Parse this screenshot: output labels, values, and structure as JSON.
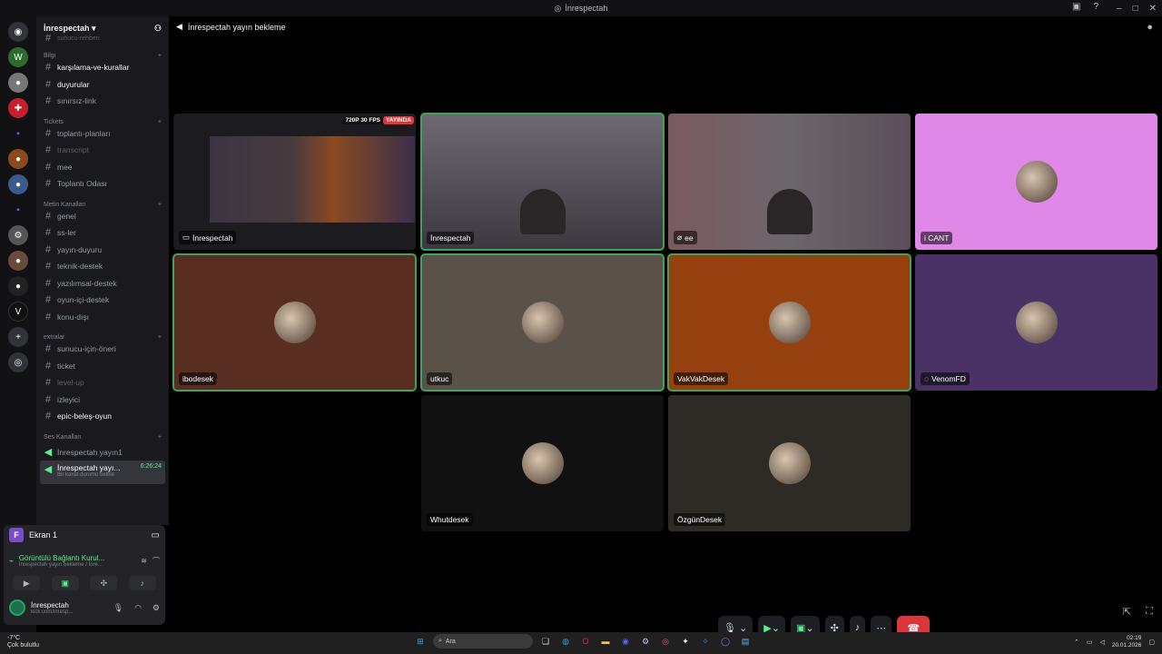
{
  "window": {
    "title": "İnrespectah"
  },
  "server": {
    "name": "İnrespectah"
  },
  "sidebar": {
    "top_partial": "sunucu-rehberi",
    "categories": [
      {
        "name": "Bilgi",
        "channels": [
          {
            "name": "karşılama-ve-kurallar",
            "state": "bright"
          },
          {
            "name": "duyurular",
            "state": "bright"
          },
          {
            "name": "sınırsız-link",
            "state": "normal"
          }
        ]
      },
      {
        "name": "Tickets",
        "channels": [
          {
            "name": "toplantı-planları",
            "state": "normal"
          },
          {
            "name": "transcript",
            "state": "dim"
          },
          {
            "name": "mee",
            "state": "normal"
          },
          {
            "name": "Toplantı Odası",
            "state": "normal"
          }
        ]
      },
      {
        "name": "Metin Kanalları",
        "channels": [
          {
            "name": "genel",
            "state": "normal"
          },
          {
            "name": "ss-ler",
            "state": "normal"
          },
          {
            "name": "yayın-duyuru",
            "state": "normal"
          },
          {
            "name": "teknik-destek",
            "state": "normal"
          },
          {
            "name": "yazılımsal-destek",
            "state": "normal"
          },
          {
            "name": "oyun-içi-destek",
            "state": "normal"
          },
          {
            "name": "konu-dışı",
            "state": "normal"
          }
        ]
      },
      {
        "name": "extralar",
        "channels": [
          {
            "name": "sunucu-için-öneri",
            "state": "normal"
          },
          {
            "name": "ticket",
            "state": "normal"
          },
          {
            "name": "level-up",
            "state": "dim"
          },
          {
            "name": "izleyici",
            "state": "normal"
          },
          {
            "name": "epic-beleş-oyun",
            "state": "bright"
          }
        ]
      }
    ],
    "voice_category": "Ses Kanalları",
    "voice_channels": [
      {
        "name": "İnrespectah yayın1"
      },
      {
        "name": "İnrespectah yayı...",
        "time": "6:26:24",
        "status": "Bir kanal durumu belirle"
      }
    ]
  },
  "panel": {
    "screen_label": "Ekran 1",
    "screen_avatar": "F",
    "voice_status": "Görüntülü Bağlantı Kurul...",
    "voice_sub": "İnrespectah yayın bekleme / İnre...",
    "user_name": "İnrespectah",
    "user_status": "kick.com/inresp..."
  },
  "stage": {
    "channel_title": "İnrespectah yayın bekleme",
    "stream_badge_quality": "720P 30 FPS",
    "stream_badge_live": "YAYINDA"
  },
  "tiles": [
    {
      "name": "İnrespectah",
      "type": "stream",
      "speaking": false,
      "icon": "screen-share-icon"
    },
    {
      "name": "İnrespectah",
      "type": "camera",
      "speaking": true
    },
    {
      "name": "ee",
      "type": "camera",
      "speaking": false,
      "icon": "mic-muted-icon"
    },
    {
      "name": "i CANT",
      "type": "avatar",
      "bg": "#e088e8",
      "speaking": false
    },
    {
      "name": "ibodesek",
      "type": "avatar",
      "bg": "#5a2d22",
      "speaking": true
    },
    {
      "name": "utkuc",
      "type": "avatar",
      "bg": "#5a5249",
      "speaking": true
    },
    {
      "name": "VakVakDesek",
      "type": "avatar",
      "bg": "#96400f",
      "speaking": true
    },
    {
      "name": "VenomFD",
      "type": "avatar",
      "bg": "#4a3266",
      "speaking": false,
      "icon": "deafened-icon"
    },
    {
      "name": "Whutdesek",
      "type": "avatar",
      "bg": "#111111",
      "speaking": false
    },
    {
      "name": "ÖzgünDesek",
      "type": "avatar",
      "bg": "#2e2a25",
      "speaking": false
    }
  ],
  "taskbar": {
    "weather_temp": "-7°C",
    "weather_text": "Çok bulutlu",
    "search_placeholder": "Ara",
    "time": "02:19",
    "date": "20.01.2026"
  },
  "colors": {
    "speaking": "#3ba55d",
    "end_call": "#da373c",
    "online": "#23a55a"
  }
}
